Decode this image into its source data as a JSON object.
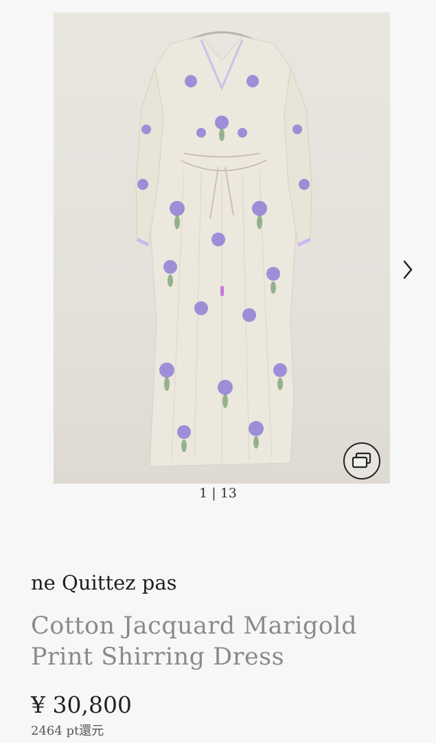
{
  "gallery": {
    "counter": "1 | 13",
    "current": 1,
    "total": 13,
    "icons": [
      "multi-image-icon",
      "chevron-right-icon"
    ]
  },
  "product": {
    "brand": "ne Quittez pas",
    "title": "Cotton Jacquard Marigold Print Shirring Dress",
    "price": "¥ 30,800",
    "points": "2464 pt還元"
  },
  "colors": {
    "background": "#f7f7f7",
    "title_gray": "#8a8a8a",
    "print_purple": "#8f7fd6",
    "print_green": "#6f9a6a"
  }
}
